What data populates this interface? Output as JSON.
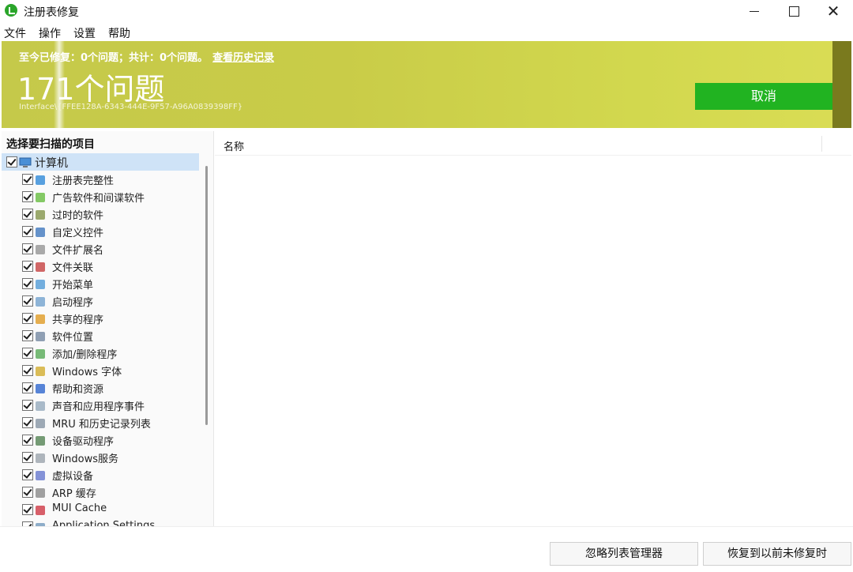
{
  "window": {
    "title": "注册表修复",
    "controls": {
      "minimize": "",
      "maximize": "",
      "close": "✕"
    }
  },
  "menu": [
    "文件",
    "操作",
    "设置",
    "帮助"
  ],
  "banner": {
    "stats_text": "至今已修复：0个问题；共计：0个问题。",
    "history_link": "查看历史记录",
    "problem_count": "171个问题",
    "current_path": "Interface\\{FFEE128A-6343-444E-9F57-A96A0839398FF}",
    "cancel_label": "取消",
    "accent_color": "#c9cc48",
    "button_color": "#21b321"
  },
  "left_panel": {
    "header": "选择要扫描的项目",
    "root": {
      "label": "计算机",
      "icon": "computer-icon",
      "checked": true
    },
    "items": [
      {
        "label": "注册表完整性",
        "icon": "registry-icon",
        "checked": true
      },
      {
        "label": "广告软件和间谍软件",
        "icon": "adware-icon",
        "checked": true
      },
      {
        "label": "过时的软件",
        "icon": "trash-icon",
        "checked": true
      },
      {
        "label": "自定义控件",
        "icon": "controls-icon",
        "checked": true
      },
      {
        "label": "文件扩展名",
        "icon": "file-icon",
        "checked": true
      },
      {
        "label": "文件关联",
        "icon": "font-file-icon",
        "checked": true
      },
      {
        "label": "开始菜单",
        "icon": "menu-icon",
        "checked": true
      },
      {
        "label": "启动程序",
        "icon": "window-icon",
        "checked": true
      },
      {
        "label": "共享的程序",
        "icon": "share-icon",
        "checked": true
      },
      {
        "label": "软件位置",
        "icon": "location-icon",
        "checked": true
      },
      {
        "label": "添加/删除程序",
        "icon": "recycle-icon",
        "checked": true
      },
      {
        "label": "Windows 字体",
        "icon": "font-icon",
        "checked": true
      },
      {
        "label": "帮助和资源",
        "icon": "help-icon",
        "checked": true
      },
      {
        "label": "声音和应用程序事件",
        "icon": "sound-icon",
        "checked": true
      },
      {
        "label": "MRU 和历史记录列表",
        "icon": "history-icon",
        "checked": true
      },
      {
        "label": "设备驱动程序",
        "icon": "driver-icon",
        "checked": true
      },
      {
        "label": "Windows服务",
        "icon": "service-icon",
        "checked": true
      },
      {
        "label": "虚拟设备",
        "icon": "virtual-device-icon",
        "checked": true
      },
      {
        "label": "ARP 缓存",
        "icon": "arp-icon",
        "checked": true
      },
      {
        "label": "MUI Cache",
        "icon": "cache-icon",
        "checked": true
      },
      {
        "label": "Application Settings",
        "icon": "app-settings-icon",
        "checked": true
      }
    ]
  },
  "right_panel": {
    "column_name": "名称"
  },
  "buttons": {
    "ignore_list": "忽略列表管理器",
    "restore": "恢复到以前未修复时"
  }
}
